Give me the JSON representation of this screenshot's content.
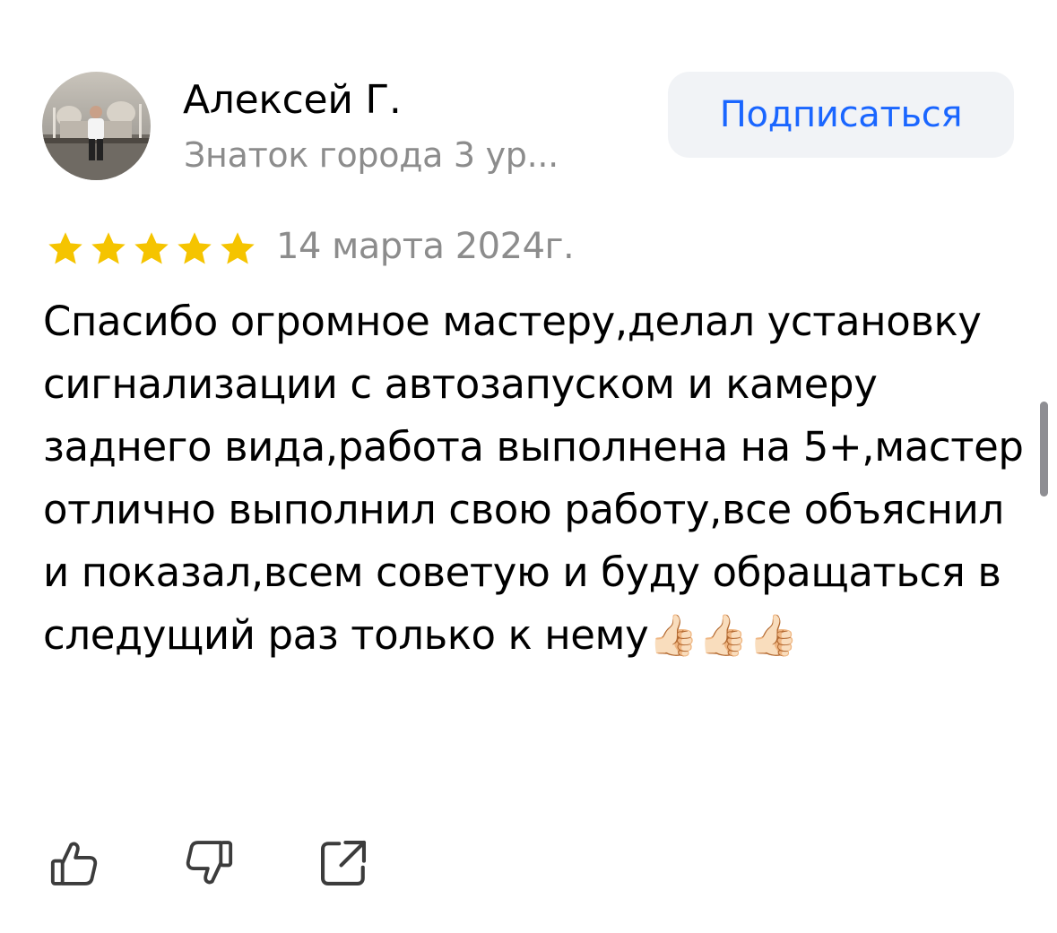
{
  "author": {
    "name": "Алексей Г.",
    "level": "Знаток города 3 ур..."
  },
  "subscribe_label": "Подписаться",
  "review": {
    "rating": 5,
    "rating_max": 5,
    "date": "14 марта 2024г.",
    "text": "Спасибо огромное мастеру,делал установку сигнализации с автозапуском и камеру заднего вида,работа выполнена на 5+,мастер отлично выполнил свою работу,все объяснил и показал,всем советую и буду обращаться в следущий раз только к нему👍🏻👍🏻👍🏻"
  },
  "actions": [
    {
      "icon": "thumbs-up-icon"
    },
    {
      "icon": "thumbs-down-icon"
    },
    {
      "icon": "share-icon"
    }
  ],
  "colors": {
    "accent": "#1a66ff",
    "star": "#f5c400",
    "secondary_text": "#8c8c8c",
    "button_bg": "#f1f3f6"
  }
}
